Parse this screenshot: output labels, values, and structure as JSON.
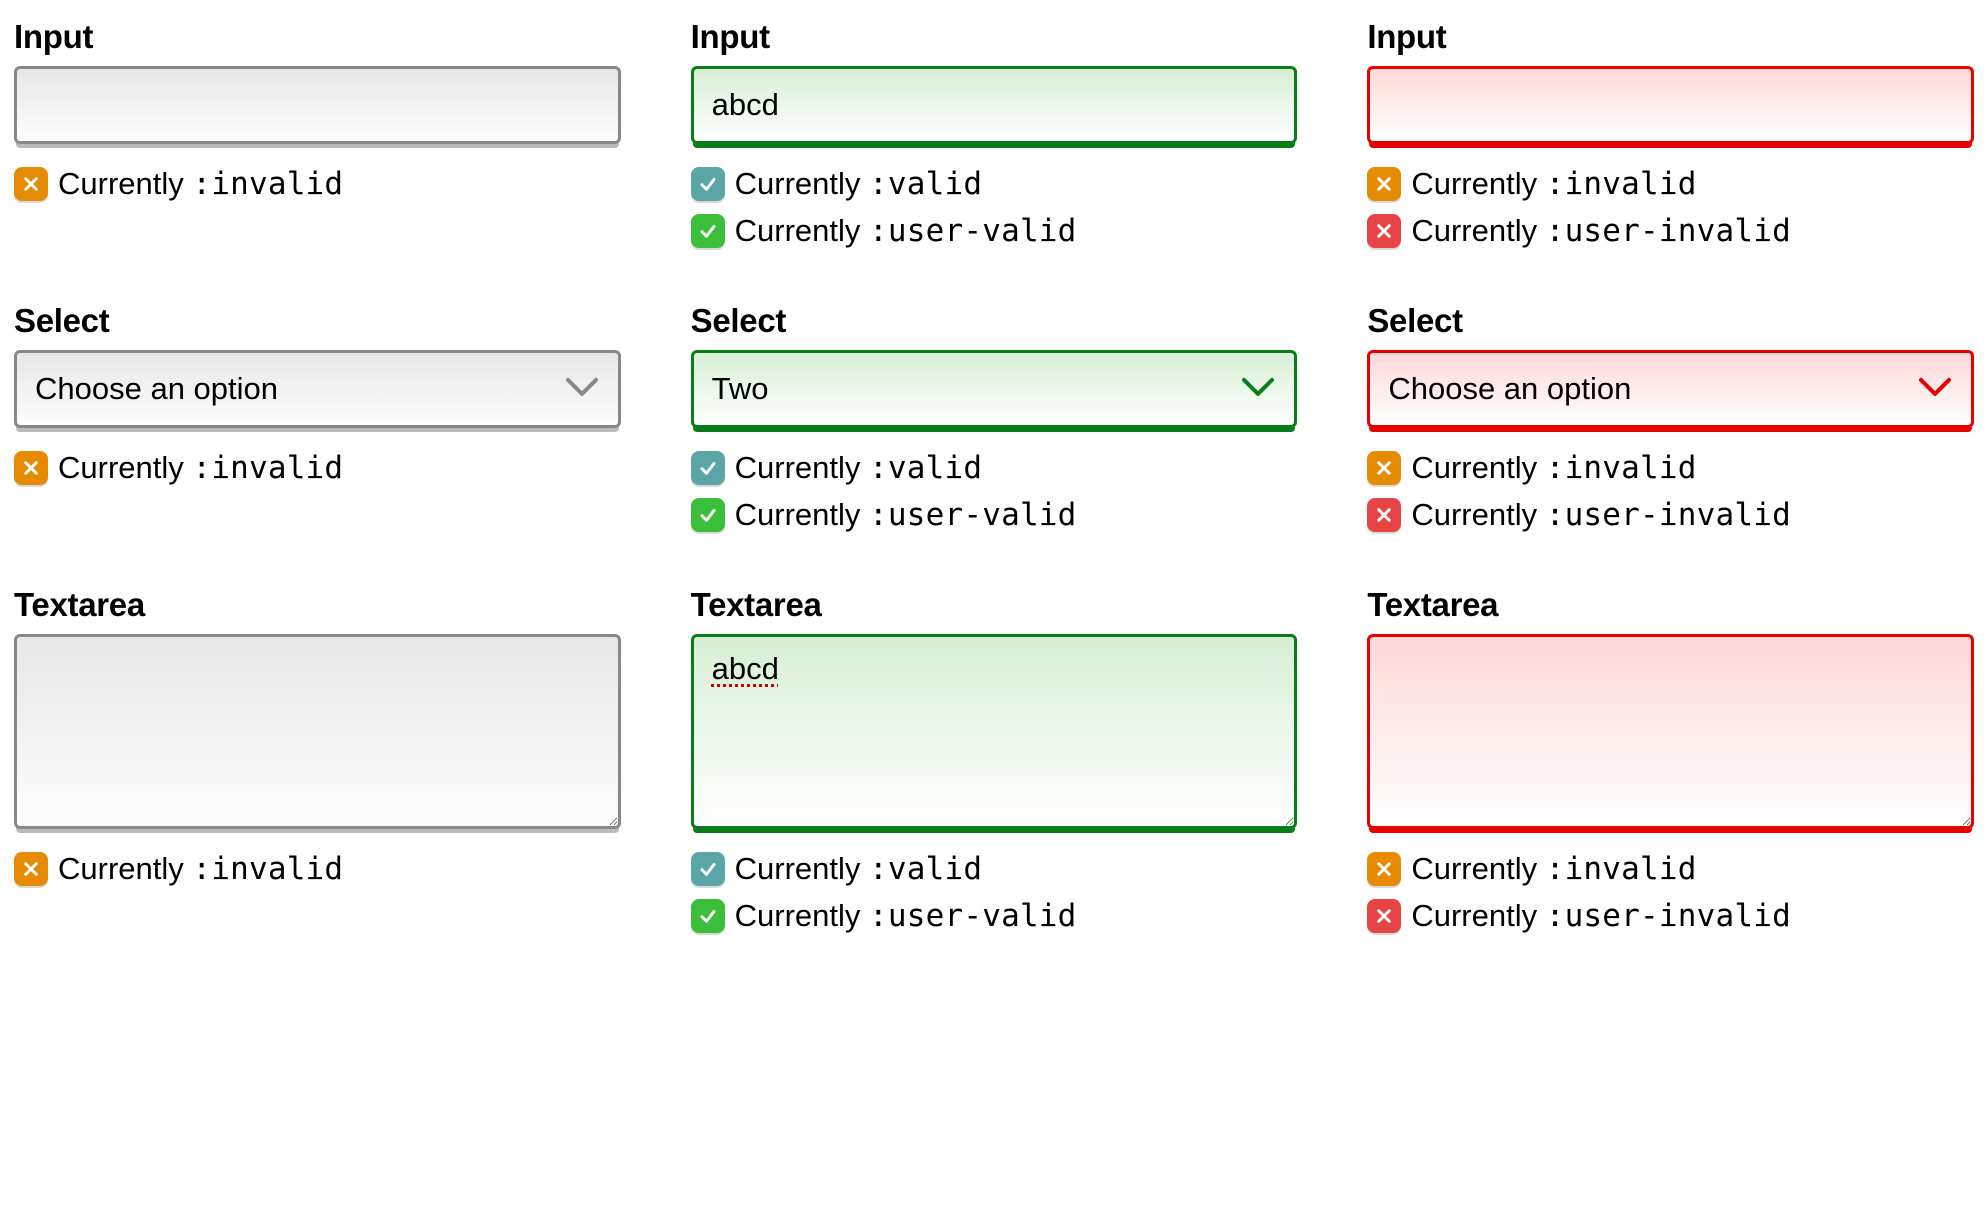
{
  "labels": {
    "input": "Input",
    "select": "Select",
    "textarea": "Textarea"
  },
  "status_text": {
    "currently": "Currently ",
    "invalid": ":invalid",
    "valid": ":valid",
    "user_valid": ":user-valid",
    "user_invalid": ":user-invalid"
  },
  "icons": {
    "orange_x": "x-orange",
    "teal_check": "check-teal",
    "green_check": "check-green",
    "red_x": "x-red"
  },
  "colors": {
    "neutral_border": "#888888",
    "valid_border": "#0a7d1b",
    "invalid_border": "#e60000",
    "badge_orange": "#e68a00",
    "badge_teal": "#5aa6a6",
    "badge_green": "#3bbf3b",
    "badge_red": "#e64545"
  },
  "select_options": {
    "placeholder": "Choose an option",
    "two": "Two"
  },
  "cells": [
    {
      "id": "input-neutral",
      "type": "input",
      "state": "neutral",
      "value": "",
      "statuses": [
        {
          "icon": "orange_x",
          "pseudo": "invalid"
        }
      ]
    },
    {
      "id": "input-valid",
      "type": "input",
      "state": "valid",
      "value": "abcd",
      "statuses": [
        {
          "icon": "teal_check",
          "pseudo": "valid"
        },
        {
          "icon": "green_check",
          "pseudo": "user_valid"
        }
      ]
    },
    {
      "id": "input-invalid",
      "type": "input",
      "state": "invalid",
      "value": "",
      "statuses": [
        {
          "icon": "orange_x",
          "pseudo": "invalid"
        },
        {
          "icon": "red_x",
          "pseudo": "user_invalid"
        }
      ]
    },
    {
      "id": "select-neutral",
      "type": "select",
      "state": "neutral",
      "selected": "placeholder",
      "statuses": [
        {
          "icon": "orange_x",
          "pseudo": "invalid"
        }
      ]
    },
    {
      "id": "select-valid",
      "type": "select",
      "state": "valid",
      "selected": "two",
      "statuses": [
        {
          "icon": "teal_check",
          "pseudo": "valid"
        },
        {
          "icon": "green_check",
          "pseudo": "user_valid"
        }
      ]
    },
    {
      "id": "select-invalid",
      "type": "select",
      "state": "invalid",
      "selected": "placeholder",
      "statuses": [
        {
          "icon": "orange_x",
          "pseudo": "invalid"
        },
        {
          "icon": "red_x",
          "pseudo": "user_invalid"
        }
      ]
    },
    {
      "id": "textarea-neutral",
      "type": "textarea",
      "state": "neutral",
      "value": "",
      "spellmark": false,
      "statuses": [
        {
          "icon": "orange_x",
          "pseudo": "invalid"
        }
      ]
    },
    {
      "id": "textarea-valid",
      "type": "textarea",
      "state": "valid",
      "value": "abcd",
      "spellmark": true,
      "statuses": [
        {
          "icon": "teal_check",
          "pseudo": "valid"
        },
        {
          "icon": "green_check",
          "pseudo": "user_valid"
        }
      ]
    },
    {
      "id": "textarea-invalid",
      "type": "textarea",
      "state": "invalid",
      "value": "",
      "spellmark": false,
      "statuses": [
        {
          "icon": "orange_x",
          "pseudo": "invalid"
        },
        {
          "icon": "red_x",
          "pseudo": "user_invalid"
        }
      ]
    }
  ]
}
